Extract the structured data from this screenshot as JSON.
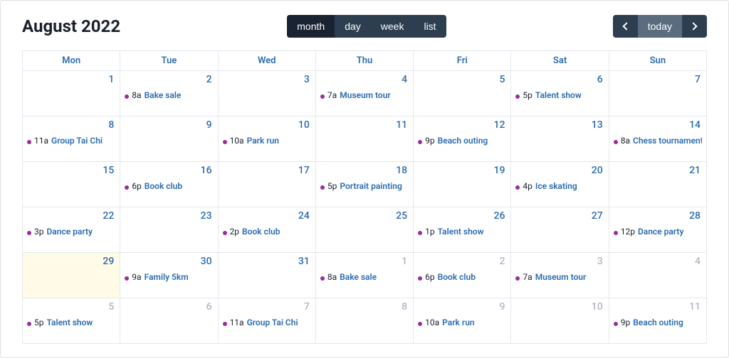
{
  "header": {
    "title": "August 2022",
    "views": [
      "month",
      "day",
      "week",
      "list"
    ],
    "active_view": "month",
    "today_label": "today"
  },
  "day_names": [
    "Mon",
    "Tue",
    "Wed",
    "Thu",
    "Fri",
    "Sat",
    "Sun"
  ],
  "weeks": [
    [
      {
        "date": "1",
        "other": false,
        "hl": false,
        "events": []
      },
      {
        "date": "2",
        "other": false,
        "hl": false,
        "events": [
          {
            "time": "8a",
            "title": "Bake sale"
          }
        ]
      },
      {
        "date": "3",
        "other": false,
        "hl": false,
        "events": []
      },
      {
        "date": "4",
        "other": false,
        "hl": false,
        "events": [
          {
            "time": "7a",
            "title": "Museum tour"
          }
        ]
      },
      {
        "date": "5",
        "other": false,
        "hl": false,
        "events": []
      },
      {
        "date": "6",
        "other": false,
        "hl": false,
        "events": [
          {
            "time": "5p",
            "title": "Talent show"
          }
        ]
      },
      {
        "date": "7",
        "other": false,
        "hl": false,
        "events": []
      }
    ],
    [
      {
        "date": "8",
        "other": false,
        "hl": false,
        "events": [
          {
            "time": "11a",
            "title": "Group Tai Chi"
          }
        ]
      },
      {
        "date": "9",
        "other": false,
        "hl": false,
        "events": []
      },
      {
        "date": "10",
        "other": false,
        "hl": false,
        "events": [
          {
            "time": "10a",
            "title": "Park run"
          }
        ]
      },
      {
        "date": "11",
        "other": false,
        "hl": false,
        "events": []
      },
      {
        "date": "12",
        "other": false,
        "hl": false,
        "events": [
          {
            "time": "9p",
            "title": "Beach outing"
          }
        ]
      },
      {
        "date": "13",
        "other": false,
        "hl": false,
        "events": []
      },
      {
        "date": "14",
        "other": false,
        "hl": false,
        "events": [
          {
            "time": "8a",
            "title": "Chess tournament"
          }
        ]
      }
    ],
    [
      {
        "date": "15",
        "other": false,
        "hl": false,
        "events": []
      },
      {
        "date": "16",
        "other": false,
        "hl": false,
        "events": [
          {
            "time": "6p",
            "title": "Book club"
          }
        ]
      },
      {
        "date": "17",
        "other": false,
        "hl": false,
        "events": []
      },
      {
        "date": "18",
        "other": false,
        "hl": false,
        "events": [
          {
            "time": "5p",
            "title": "Portrait painting"
          }
        ]
      },
      {
        "date": "19",
        "other": false,
        "hl": false,
        "events": []
      },
      {
        "date": "20",
        "other": false,
        "hl": false,
        "events": [
          {
            "time": "4p",
            "title": "Ice skating"
          }
        ]
      },
      {
        "date": "21",
        "other": false,
        "hl": false,
        "events": []
      }
    ],
    [
      {
        "date": "22",
        "other": false,
        "hl": false,
        "events": [
          {
            "time": "3p",
            "title": "Dance party"
          }
        ]
      },
      {
        "date": "23",
        "other": false,
        "hl": false,
        "events": []
      },
      {
        "date": "24",
        "other": false,
        "hl": false,
        "events": [
          {
            "time": "2p",
            "title": "Book club"
          }
        ]
      },
      {
        "date": "25",
        "other": false,
        "hl": false,
        "events": []
      },
      {
        "date": "26",
        "other": false,
        "hl": false,
        "events": [
          {
            "time": "1p",
            "title": "Talent show"
          }
        ]
      },
      {
        "date": "27",
        "other": false,
        "hl": false,
        "events": []
      },
      {
        "date": "28",
        "other": false,
        "hl": false,
        "events": [
          {
            "time": "12p",
            "title": "Dance party"
          }
        ]
      }
    ],
    [
      {
        "date": "29",
        "other": false,
        "hl": true,
        "events": []
      },
      {
        "date": "30",
        "other": false,
        "hl": false,
        "events": [
          {
            "time": "9a",
            "title": "Family 5km"
          }
        ]
      },
      {
        "date": "31",
        "other": false,
        "hl": false,
        "events": []
      },
      {
        "date": "1",
        "other": true,
        "hl": false,
        "events": [
          {
            "time": "8a",
            "title": "Bake sale"
          }
        ]
      },
      {
        "date": "2",
        "other": true,
        "hl": false,
        "events": [
          {
            "time": "6p",
            "title": "Book club"
          }
        ]
      },
      {
        "date": "3",
        "other": true,
        "hl": false,
        "events": [
          {
            "time": "7a",
            "title": "Museum tour"
          }
        ]
      },
      {
        "date": "4",
        "other": true,
        "hl": false,
        "events": []
      }
    ],
    [
      {
        "date": "5",
        "other": true,
        "hl": false,
        "events": [
          {
            "time": "5p",
            "title": "Talent show"
          }
        ]
      },
      {
        "date": "6",
        "other": true,
        "hl": false,
        "events": []
      },
      {
        "date": "7",
        "other": true,
        "hl": false,
        "events": [
          {
            "time": "11a",
            "title": "Group Tai Chi"
          }
        ]
      },
      {
        "date": "8",
        "other": true,
        "hl": false,
        "events": []
      },
      {
        "date": "9",
        "other": true,
        "hl": false,
        "events": [
          {
            "time": "10a",
            "title": "Park run"
          }
        ]
      },
      {
        "date": "10",
        "other": true,
        "hl": false,
        "events": []
      },
      {
        "date": "11",
        "other": true,
        "hl": false,
        "events": [
          {
            "time": "9p",
            "title": "Beach outing"
          }
        ]
      }
    ]
  ]
}
